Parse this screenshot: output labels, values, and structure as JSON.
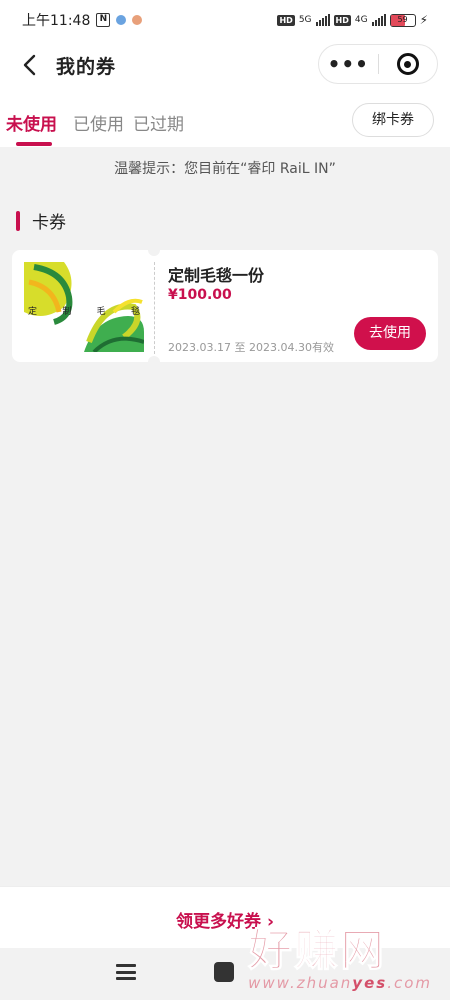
{
  "status_bar": {
    "time": "上午11:48",
    "battery": "59",
    "net1": "5G",
    "net2": "4G",
    "hd": "HD"
  },
  "header": {
    "title": "我的券",
    "more_glyph": "•••"
  },
  "tabs": [
    {
      "label": "未使用",
      "active": true
    },
    {
      "label": "已使用",
      "active": false
    },
    {
      "label": "已过期",
      "active": false
    }
  ],
  "bind_card_label": "绑卡券",
  "notice": "温馨提示：您目前在“睿印 RaiL IN”",
  "section_title": "卡券",
  "coupons": [
    {
      "name": "定制毛毯一份",
      "price": "¥100.00",
      "validity": "2023.03.17 至 2023.04.30有效",
      "action_label": "去使用",
      "thumb_text": [
        "定",
        "制",
        "毛",
        "毯"
      ]
    }
  ],
  "bottom": {
    "more_label": "领更多好券",
    "chevron": "›"
  },
  "watermark": {
    "big": "好赚网",
    "small_a": "www.zhuan",
    "small_b": "yes",
    "small_c": ".com"
  },
  "colors": {
    "accent": "#c8104e",
    "background": "#f2f2f2"
  }
}
